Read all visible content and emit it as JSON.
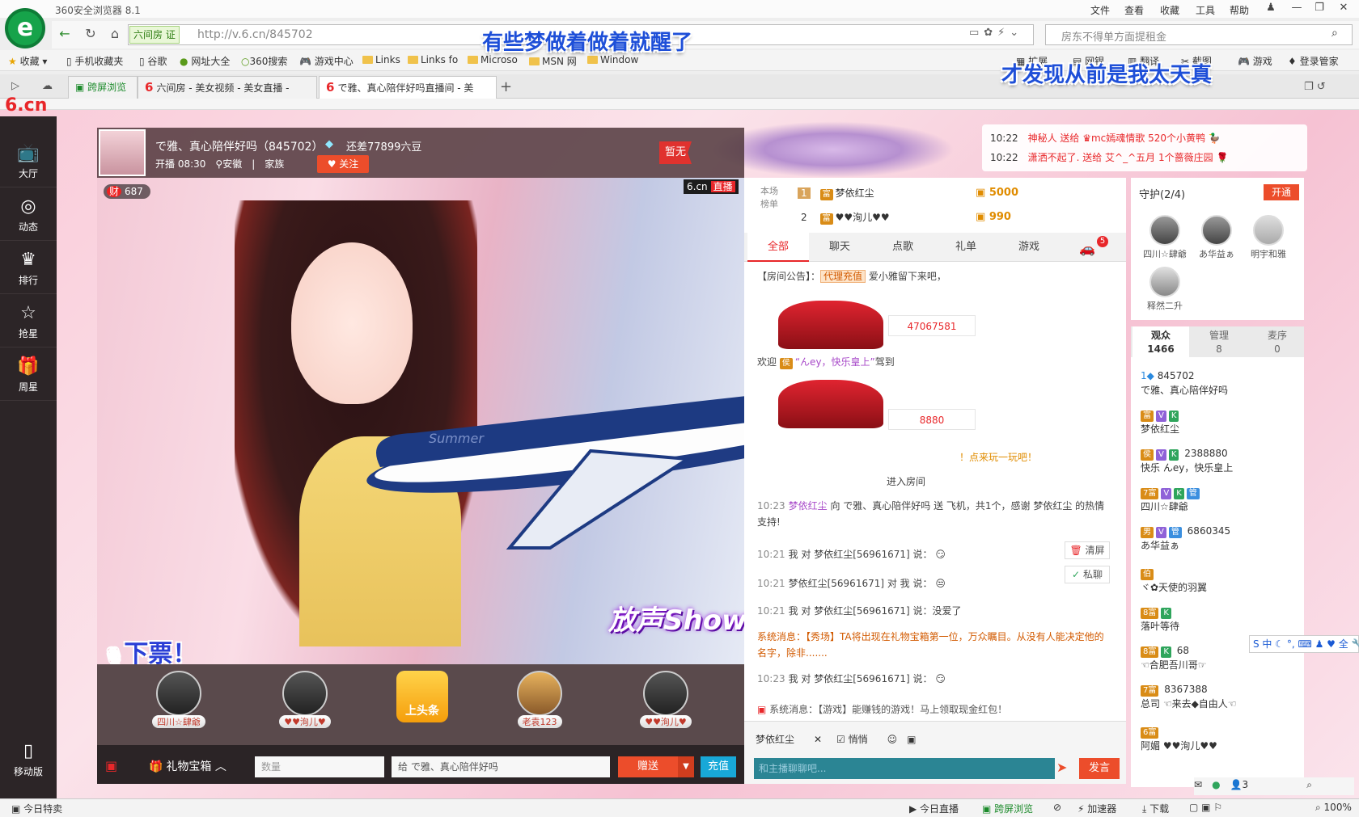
{
  "browser": {
    "title": "360安全浏览器 8.1",
    "menus": [
      "文件",
      "查看",
      "收藏",
      "工具",
      "帮助"
    ],
    "site_badge": "六间房 证",
    "url": "http://v.6.cn/845702",
    "search_placeholder": "房东不得单方面提租金",
    "bookmarks": [
      "收藏",
      "手机收藏夹",
      "谷歌",
      "网址大全",
      "360搜索",
      "游戏中心",
      "Links",
      "Links fo",
      "Microso",
      "MSN 网",
      "Window"
    ],
    "right_tools": [
      "扩展",
      "网银",
      "翻译",
      "截图",
      "游戏",
      "登录管家"
    ],
    "tabs": [
      "跨屏浏览",
      "六间房 - 美女视频 - 美女直播 -",
      "で雅、真心陪伴好吗直播间 - 美"
    ],
    "lyric1": "有些梦做着做着就醒了",
    "lyric2": "才发现从前是我太天真"
  },
  "nav": {
    "logo": "6.cn",
    "items": [
      "大厅",
      "动态",
      "排行",
      "抢星",
      "周星"
    ],
    "mobile": "移动版"
  },
  "anchor": {
    "name": "で雅、真心陪伴好吗（845702）",
    "need": "还差77899六豆",
    "start": "开播 08:30",
    "location": "安徽",
    "family": "家族",
    "follow": "关注",
    "flag": "暂无"
  },
  "video": {
    "rich_count": "687",
    "site": "6.cn",
    "live": "直播",
    "show": "放声Show唱",
    "overlay": "下票！"
  },
  "fans": [
    "四川☆肆爺",
    "♥♥洵儿♥",
    "上头条",
    "老袁123",
    "♥♥洵儿♥"
  ],
  "gift": {
    "box": "礼物宝箱",
    "qty_placeholder": "数量",
    "target": "给 で雅、真心陪伴好吗",
    "send": "赠送",
    "recharge": "充值"
  },
  "rank": {
    "label": "本场榜单",
    "rows": [
      {
        "n": "1",
        "name": "梦依红尘",
        "beans": "5000"
      },
      {
        "n": "2",
        "name": "♥♥洵儿♥♥",
        "beans": "990"
      }
    ]
  },
  "chat": {
    "tabs": [
      "全部",
      "聊天",
      "点歌",
      "礼单",
      "游戏"
    ],
    "car_badge": "5",
    "notice_label": "【房间公告】：",
    "notice_tag": "代理充值",
    "notice_text": "爱小雅留下来吧，",
    "car1_num": "47067581",
    "car2_num": "8880",
    "welcome": "欢迎",
    "welcome_user": "“んey，快乐皇上”",
    "welcome_tail": "驾到",
    "game_hint": "！点来玩一玩吧！",
    "enter": "进入房间",
    "m1_time": "10:23",
    "m1_user": "梦依红尘",
    "m1_text": "向 で雅、真心陪伴好吗 送 飞机，共1个，感谢 梦依红尘 的热情支持!",
    "m2_time": "10:21",
    "m2_text": "我 对 梦依红尘[56961671] 说：",
    "m3_time": "10:21",
    "m3_text": "梦依红尘[56961671] 对 我 说：",
    "m4_time": "10:21",
    "m4_text": "我 对 梦依红尘[56961671] 说：没爱了",
    "sys1": "系统消息：【秀场】TA将出现在礼物宝箱第一位，万众瞩目。从没有人能决定他的名字，除非.......",
    "m5_time": "10:23",
    "m5_text": "我 对 梦依红尘[56961671] 说：",
    "sys2": "系统消息：【游戏】能赚钱的游戏！马上领取现金红包！",
    "clear": "清屏",
    "pm": "私聊",
    "to_user": "梦依红尘",
    "quiet": "悄悄",
    "input_placeholder": "和主播聊聊吧...",
    "post": "发言"
  },
  "gift_notice": [
    {
      "time": "10:22",
      "text": "神秘人 送给 ♛mc嫣魂情歌 520个小黄鸭"
    },
    {
      "time": "10:22",
      "text": "潇洒不起了. 送给 艾^_^五月 1个蔷薇庄园"
    }
  ],
  "guard": {
    "title": "守护(2/4)",
    "open": "开通",
    "members": [
      "四川☆肆爺",
      "あ华益ぁ",
      "明宇和雅",
      "释然二升"
    ]
  },
  "audience": {
    "tabs": [
      {
        "label": "观众",
        "count": "1466"
      },
      {
        "label": "管理",
        "count": "8"
      },
      {
        "label": "麦序",
        "count": "0"
      }
    ],
    "list": [
      {
        "line1": "845702",
        "line2": "で雅、真心陪伴好吗"
      },
      {
        "line1": "",
        "line2": "梦依红尘"
      },
      {
        "line1": "2388880",
        "line2": "快乐 んey，快乐皇上"
      },
      {
        "line1": "",
        "line2": "四川☆肆爺"
      },
      {
        "line1": "6860345",
        "line2": "あ华益ぁ"
      },
      {
        "line1": "",
        "line2": "ヾ✿天使的羽翼"
      },
      {
        "line1": "",
        "line2": "落叶等待"
      },
      {
        "line1": "68",
        "line2": "☜合肥吾川哥☞"
      },
      {
        "line1": "8367388",
        "line2": "总司 ☜来去◆自由人☜"
      },
      {
        "line1": "",
        "line2": "阿媚 ♥♥洵儿♥♥"
      }
    ],
    "bottom_count": "3"
  },
  "sogou": "S 中 ☾ °, ⌨ ♟ ♥ 全 🔧",
  "status": {
    "left": "今日特卖",
    "items": [
      "今日直播",
      "跨屏浏览",
      "加速器",
      "下载",
      "100%"
    ]
  }
}
